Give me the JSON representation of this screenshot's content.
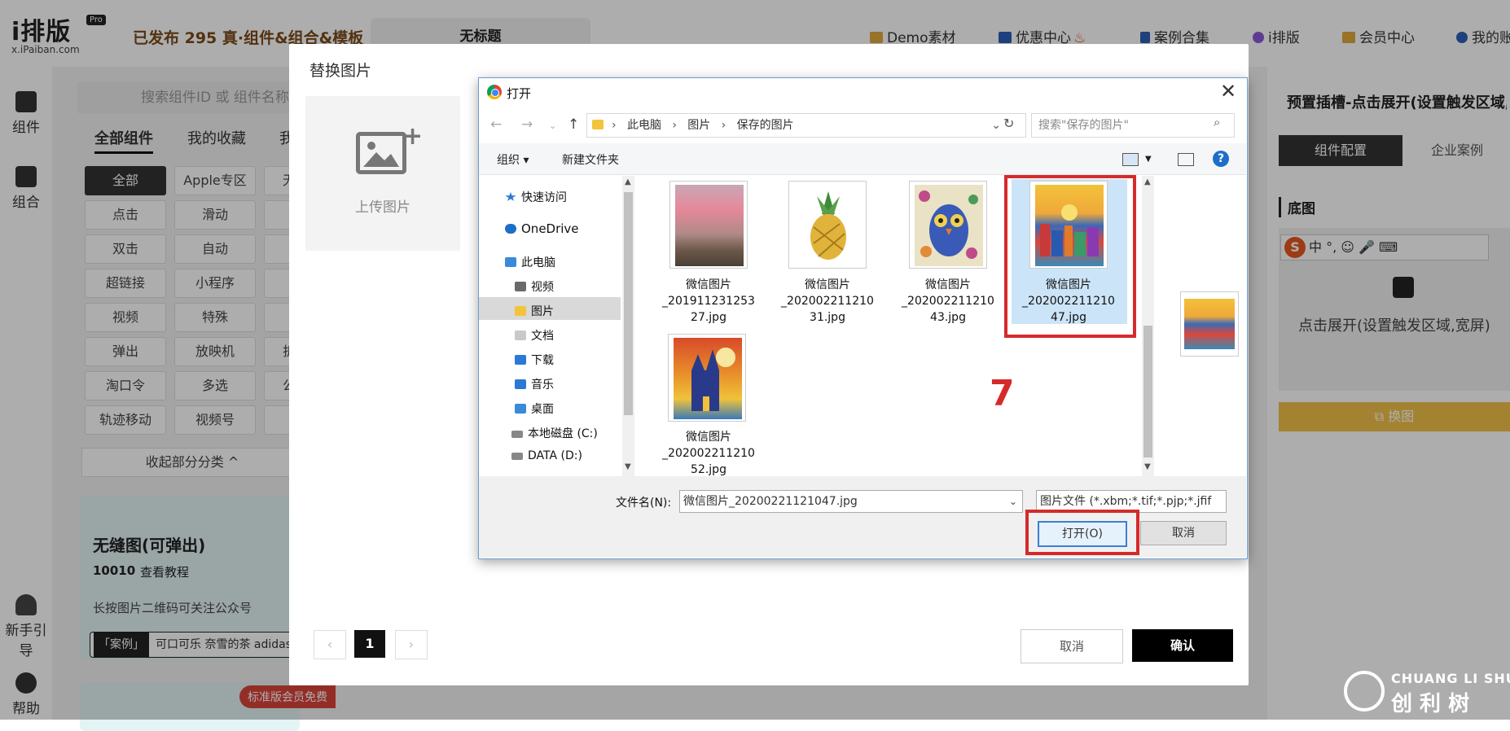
{
  "topbar": {
    "logo": "i排版",
    "logo_badge": "Pro",
    "logo_sub": "x.iPaiban.com",
    "published": "已发布 295 真·组件&组合&模板",
    "doc_tab": "无标题",
    "nav": [
      "Demo素材",
      "优惠中心",
      "案例合集",
      "i排版",
      "会员中心",
      "我的账"
    ]
  },
  "leftbar": {
    "items": [
      "组件",
      "组合",
      "新手引导",
      "帮助"
    ]
  },
  "panel": {
    "search_placeholder": "搜索组件ID 或 组件名称",
    "tabs": [
      "全部组件",
      "我的收藏",
      "我"
    ],
    "chips": [
      [
        "全部",
        "Apple专区",
        "无"
      ],
      [
        "点击",
        "滑动",
        ""
      ],
      [
        "双击",
        "自动",
        ""
      ],
      [
        "超链接",
        "小程序",
        ""
      ],
      [
        "视频",
        "特殊",
        ""
      ],
      [
        "弹出",
        "放映机",
        "折"
      ],
      [
        "淘口令",
        "多选",
        "公"
      ],
      [
        "轨迹移动",
        "视频号",
        ""
      ]
    ],
    "collapse": "收起部分分类 ^",
    "card": {
      "title": "无缝图(可弹出)",
      "id": "10010",
      "tutorial": "查看教程",
      "desc": "长按图片二维码可关注公众号",
      "case_tag": "「案例」",
      "case_text": "可口可乐  奈雪的茶  adidas"
    },
    "card2_badge": "标准版会员免费"
  },
  "rpanel": {
    "title": "预置插槽-点击展开(设置触发区域,...",
    "tab_config": "组件配置",
    "tab_case": "企业案例",
    "section": "底图",
    "ime": "中 °, ☺ 🎤 ⌨",
    "desc": "点击展开(设置触发区域,宽屏)",
    "swap": "换图"
  },
  "replace_modal": {
    "title": "替换图片",
    "upload_label": "上传图片",
    "page_current": "1",
    "cancel": "取消",
    "confirm": "确认"
  },
  "open_dialog": {
    "title": "打开",
    "close_glyph": "✕",
    "breadcrumb": [
      "此电脑",
      "图片",
      "保存的图片"
    ],
    "search_placeholder": "搜索\"保存的图片\"",
    "organize": "组织 ▾",
    "new_folder": "新建文件夹",
    "help": "?",
    "tree": [
      "快速访问",
      "OneDrive",
      "此电脑",
      "视频",
      "图片",
      "文档",
      "下载",
      "音乐",
      "桌面",
      "本地磁盘 (C:)",
      "DATA (D:)"
    ],
    "files": [
      {
        "name": "微信图片_20191123125327.jpg",
        "line1": "微信图片",
        "line2": "_201911231253",
        "line3": "27.jpg"
      },
      {
        "name": "微信图片_20200221121031.jpg",
        "line1": "微信图片",
        "line2": "_202002211210",
        "line3": "31.jpg"
      },
      {
        "name": "微信图片_20200221121043.jpg",
        "line1": "微信图片",
        "line2": "_202002211210",
        "line3": "43.jpg"
      },
      {
        "name": "微信图片_20200221121047.jpg",
        "line1": "微信图片",
        "line2": "_202002211210",
        "line3": "47.jpg"
      },
      {
        "name": "微信图片_20200221121052.jpg",
        "line1": "微信图片",
        "line2": "_202002211210",
        "line3": "52.jpg"
      }
    ],
    "step_number": "7",
    "filename_label": "文件名(N):",
    "filename_value": "微信图片_20200221121047.jpg",
    "filter": "图片文件 (*.xbm;*.tif;*.pjp;*.jfif",
    "open_btn": "打开(O)",
    "cancel_btn": "取消"
  },
  "watermark": {
    "en": "CHUANG LI SHU",
    "cn": "创 利 树"
  },
  "colors": {
    "accent_red": "#d62a2a",
    "win_blue": "#3c7fd6",
    "gold": "#f0c24a"
  }
}
